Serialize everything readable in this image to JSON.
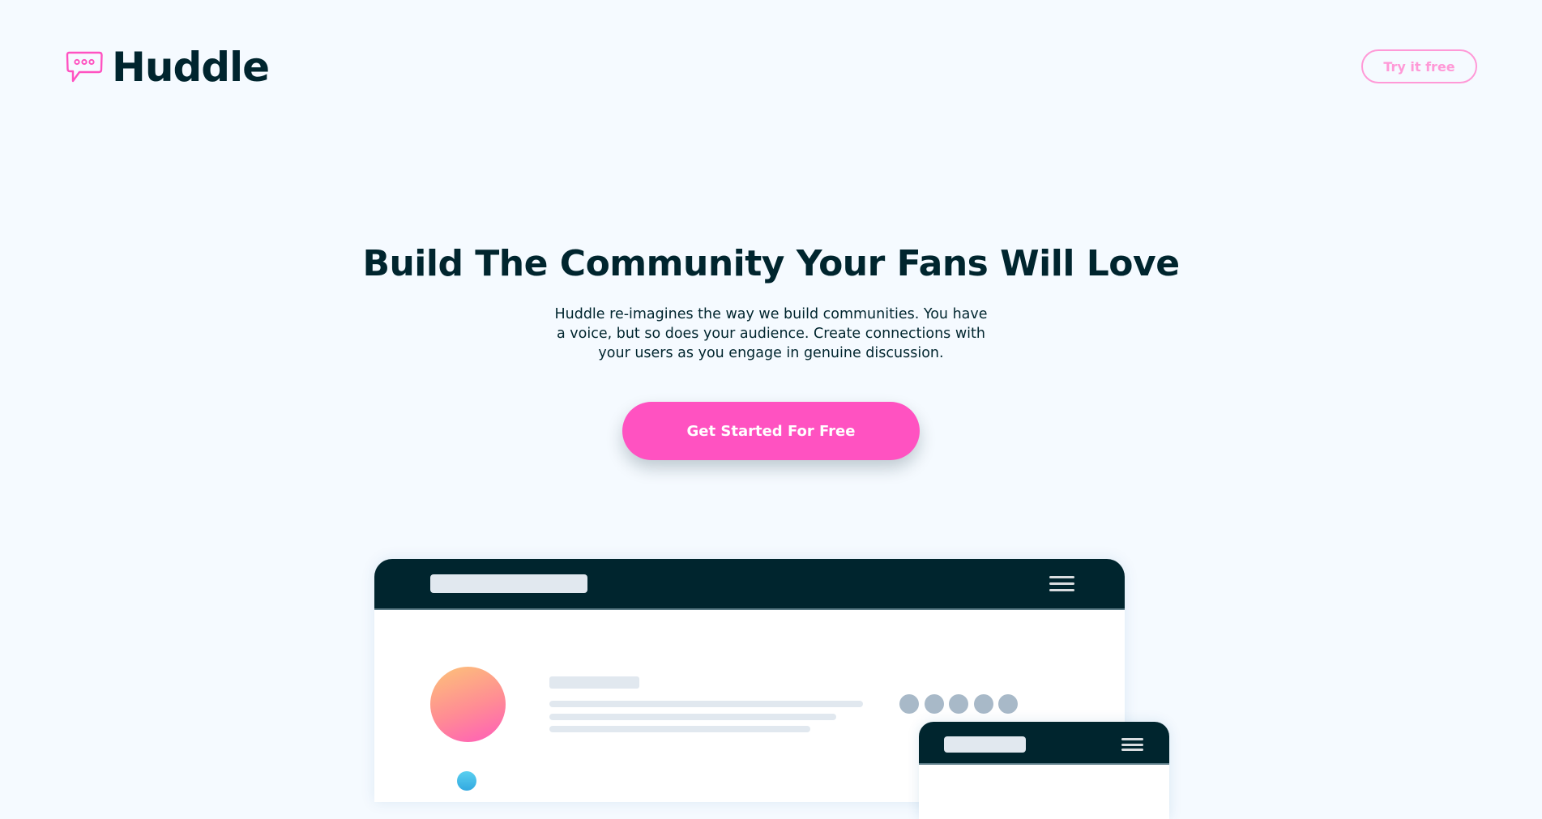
{
  "header": {
    "brand_name": "Huddle",
    "logo_icon": "chat-bubble-icon",
    "try_button_label": "Try it free"
  },
  "hero": {
    "title": "Build The Community Your Fans Will Love",
    "description": "Huddle re-imagines the way we build communities. You have a voice, but so does your audience. Create connections with your users as you engage in genuine discussion.",
    "cta_label": "Get Started For Free"
  },
  "mockups": {
    "desktop": {
      "menu_icon": "hamburger-menu-icon",
      "dot_count": 5
    },
    "mobile": {
      "menu_icon": "hamburger-menu-icon"
    }
  },
  "colors": {
    "background": "#f5faff",
    "accent_pink": "#ff52c1",
    "outline_pink": "#ff99d7",
    "dark_navy": "#00252e",
    "skeleton_gray": "#e1e8ef",
    "dot_gray": "#a8b9c8"
  }
}
